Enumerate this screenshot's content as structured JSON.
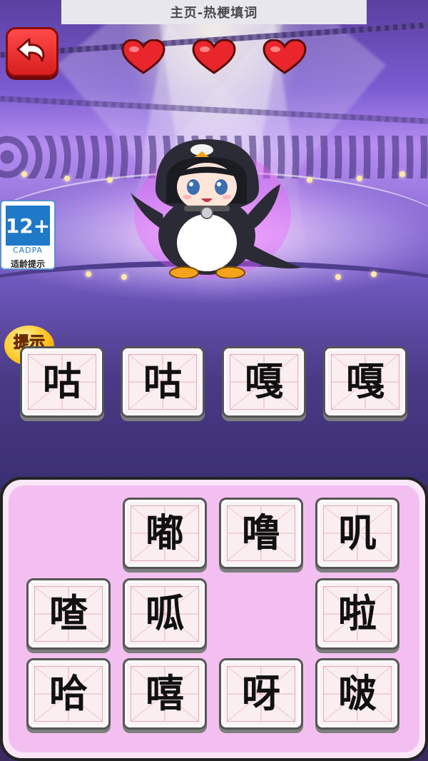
{
  "header": {
    "title": "主页-热梗填词"
  },
  "lives": {
    "total": 3,
    "remaining": 3
  },
  "age_rating": {
    "rating": "12+",
    "org": "CADPA",
    "label": "适龄提示"
  },
  "hint": {
    "label": "提示"
  },
  "answer": {
    "slots": [
      "咕",
      "咕",
      "嘎",
      "嘎"
    ]
  },
  "choices": {
    "rows": [
      [
        "",
        "嘟",
        "噜",
        "叽"
      ],
      [
        "喳",
        "呱",
        "",
        "啦"
      ],
      [
        "哈",
        "嘻",
        "呀",
        "啵"
      ]
    ]
  },
  "colors": {
    "back_button": "#e02626",
    "heart": "#e8262b",
    "panel": "#f3bff0",
    "tile": "#fbeef1"
  }
}
